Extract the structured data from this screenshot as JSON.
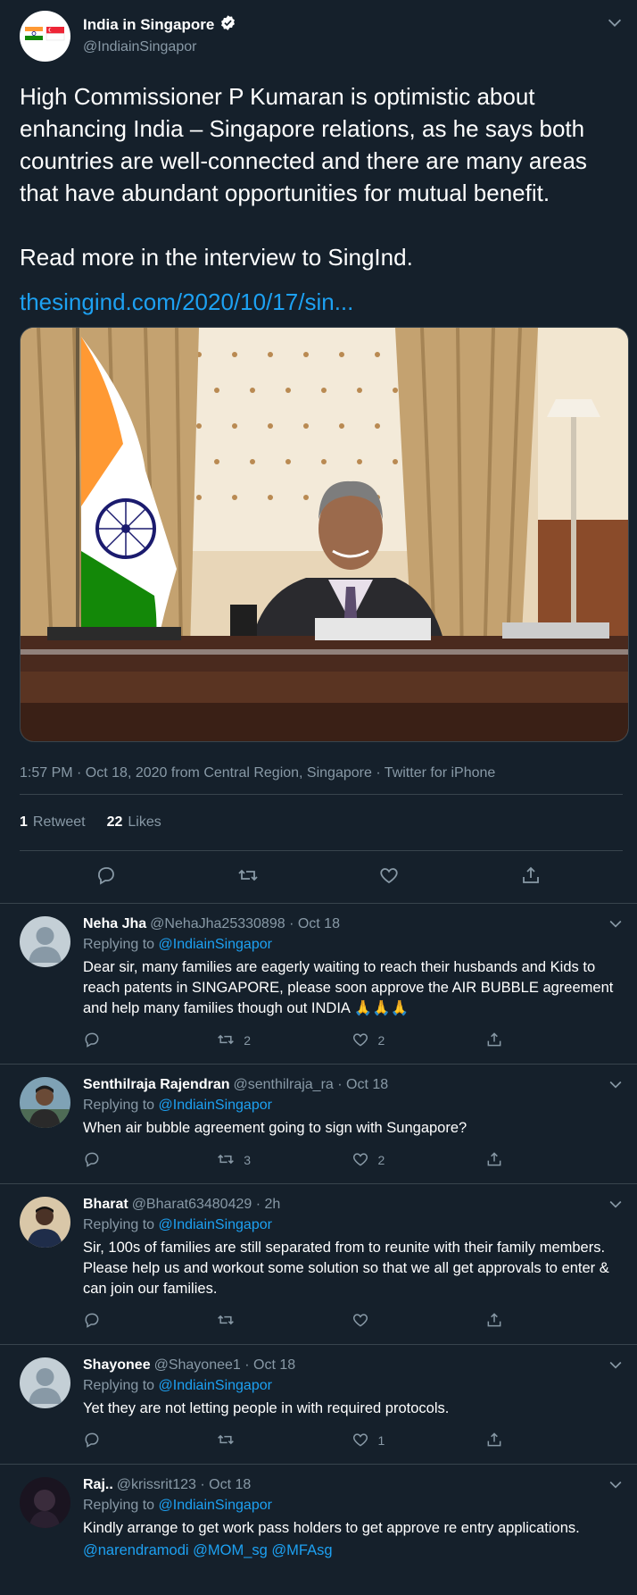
{
  "account": {
    "display_name": "India in Singapore",
    "handle": "@IndiainSingapor"
  },
  "tweet": {
    "text": "High Commissioner P Kumaran is optimistic about\nenhancing India – Singapore relations, as he says both\ncountries are well-connected and there are many areas\nthat have abundant opportunities for mutual benefit.\n\nRead more in the interview to SingInd.",
    "link": "thesingind.com/2020/10/17/sin...",
    "meta": "1:57 PM · Oct 18, 2020 from Central Region, Singapore · Twitter for iPhone",
    "retweets_count": "1",
    "retweets_label": "Retweet",
    "likes_count": "22",
    "likes_label": "Likes"
  },
  "icons": {
    "verified": "verified-badge-icon",
    "chevron": "chevron-down-icon",
    "reply": "reply-icon",
    "retweet": "retweet-icon",
    "like": "like-icon",
    "share": "share-icon"
  },
  "colors": {
    "background": "#15202b",
    "link": "#1da1f2",
    "muted": "#8899a6",
    "border": "#38444d"
  },
  "replies": [
    {
      "name": "Neha Jha",
      "handle": "@NehaJha25330898 · Oct 18",
      "replying_label": "Replying to",
      "replying_to": "@IndiainSingapor",
      "text": "Dear sir, many families are eagerly waiting to reach their husbands and Kids to reach patents in SINGAPORE, please soon approve the AIR BUBBLE agreement and help many families though out INDIA 🙏🙏🙏",
      "retweets": "2",
      "likes": "2"
    },
    {
      "name": "Senthilraja Rajendran",
      "handle": "@senthilraja_ra · Oct 18",
      "replying_label": "Replying to",
      "replying_to": "@IndiainSingapor",
      "text": "When air bubble agreement going to sign with Sungapore?",
      "retweets": "3",
      "likes": "2"
    },
    {
      "name": "Bharat",
      "handle": "@Bharat63480429 · 2h",
      "replying_label": "Replying to",
      "replying_to": "@IndiainSingapor",
      "text": "Sir, 100s of families are still separated from to reunite with their family members. Please help us and workout some solution so that we all get approvals to enter & can join our families.",
      "retweets": "",
      "likes": ""
    },
    {
      "name": "Shayonee",
      "handle": "@Shayonee1 · Oct 18",
      "replying_label": "Replying to",
      "replying_to": "@IndiainSingapor",
      "text": "Yet they are not letting people in with required protocols.",
      "retweets": "",
      "likes": "1"
    },
    {
      "name": "Raj..",
      "handle": "@krissrit123 · Oct 18",
      "replying_label": "Replying to",
      "replying_to": "@IndiainSingapor",
      "text": "Kindly arrange to get work pass holders to get approve re entry applications.",
      "mentions": "@narendramodi @MOM_sg @MFAsg",
      "retweets": "",
      "likes": ""
    }
  ]
}
